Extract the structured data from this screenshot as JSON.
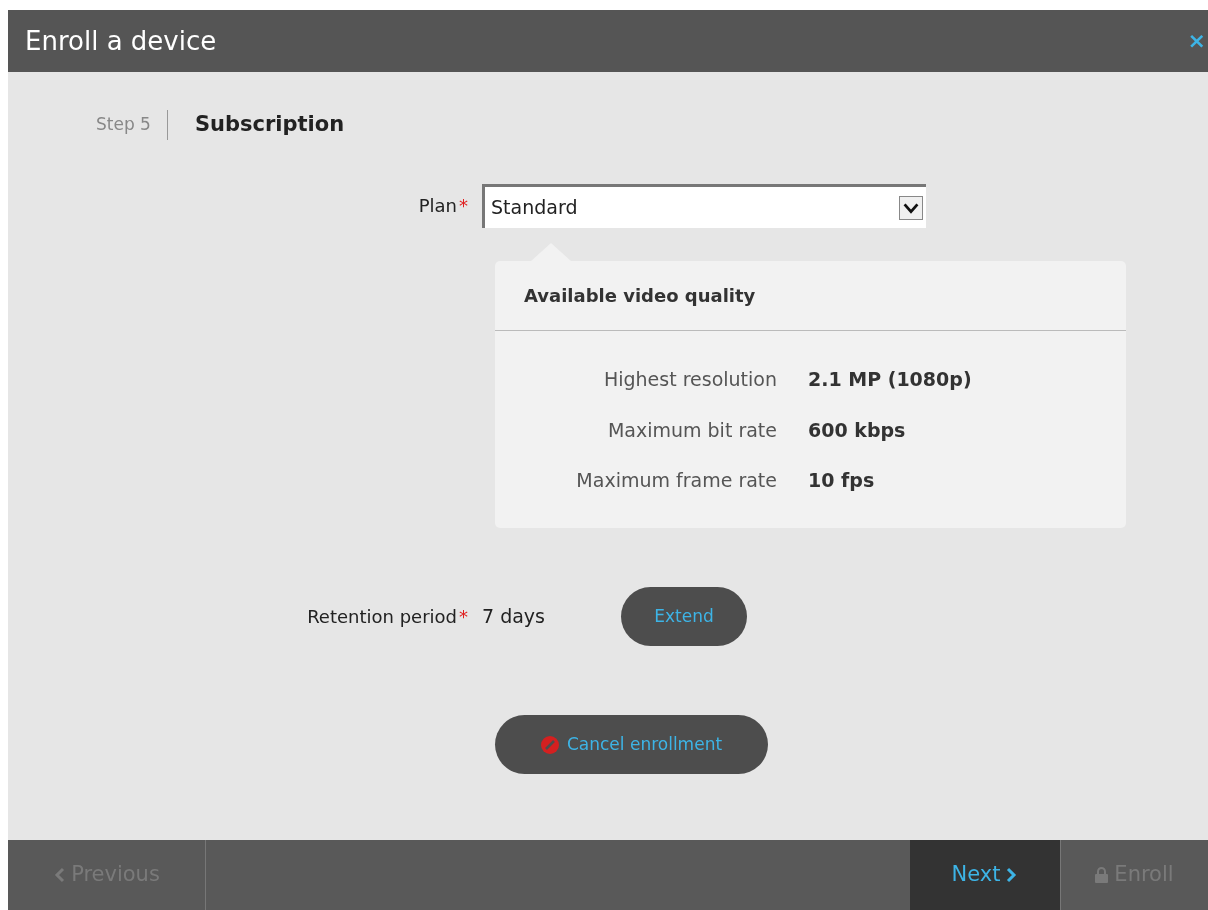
{
  "window": {
    "title": "Enroll a device",
    "close": "×"
  },
  "step": {
    "label": "Step 5",
    "title": "Subscription"
  },
  "plan": {
    "label": "Plan",
    "required_mark": "*",
    "value": "Standard"
  },
  "quality_panel": {
    "title": "Available video quality",
    "rows": [
      {
        "label": "Highest resolution",
        "value": "2.1 MP (1080p)"
      },
      {
        "label": "Maximum bit rate",
        "value": "600 kbps"
      },
      {
        "label": "Maximum frame rate",
        "value": "10 fps"
      }
    ]
  },
  "retention": {
    "label": "Retention period",
    "required_mark": "*",
    "value": "7 days",
    "button": "Extend"
  },
  "cancel_button": "Cancel enrollment",
  "footer": [
    {
      "kind": "previous",
      "label": "Previous",
      "disabled": true
    },
    {
      "kind": "next",
      "label": "Next",
      "disabled": false
    },
    {
      "kind": "enroll",
      "label": "Enroll",
      "disabled": true
    }
  ]
}
